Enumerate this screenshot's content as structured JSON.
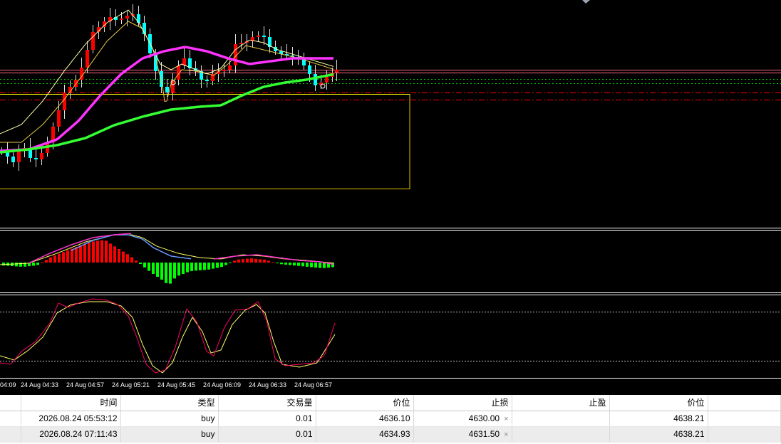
{
  "time_axis": {
    "labels": [
      "04:09",
      "24 Aug 04:33",
      "24 Aug 04:57",
      "24 Aug 05:21",
      "24 Aug 05:45",
      "24 Aug 06:09",
      "24 Aug 06:33",
      "24 Aug 06:57"
    ]
  },
  "trade_table": {
    "columns": [
      "",
      "时间",
      "类型",
      "交易量",
      "价位",
      "止损",
      "止盈",
      "价位"
    ],
    "rows": [
      {
        "time": "2026.08.24 05:53:12",
        "type": "buy",
        "volume": "0.01",
        "open_price": "4636.10",
        "stop_loss": "4630.00",
        "take_profit": "",
        "current_price": "4638.21"
      },
      {
        "time": "2026.08.24 07:11:43",
        "type": "buy",
        "volume": "0.01",
        "open_price": "4634.93",
        "stop_loss": "4631.50",
        "take_profit": "",
        "current_price": "4638.21"
      }
    ],
    "close_glyph": "×"
  },
  "colors": {
    "background": "#000000",
    "bull_candle": "#ff0000",
    "bear_candle": "#00ffff",
    "ma_fast": "#ff33ff",
    "ma_slow": "#33ff33",
    "histogram_positive": "#ff0000",
    "histogram_negative": "#00ff00",
    "stoch_main": "#ff0066",
    "stoch_signal": "#ffff66",
    "level_line": "#ffff00",
    "stop_line": "#ff0000"
  }
}
